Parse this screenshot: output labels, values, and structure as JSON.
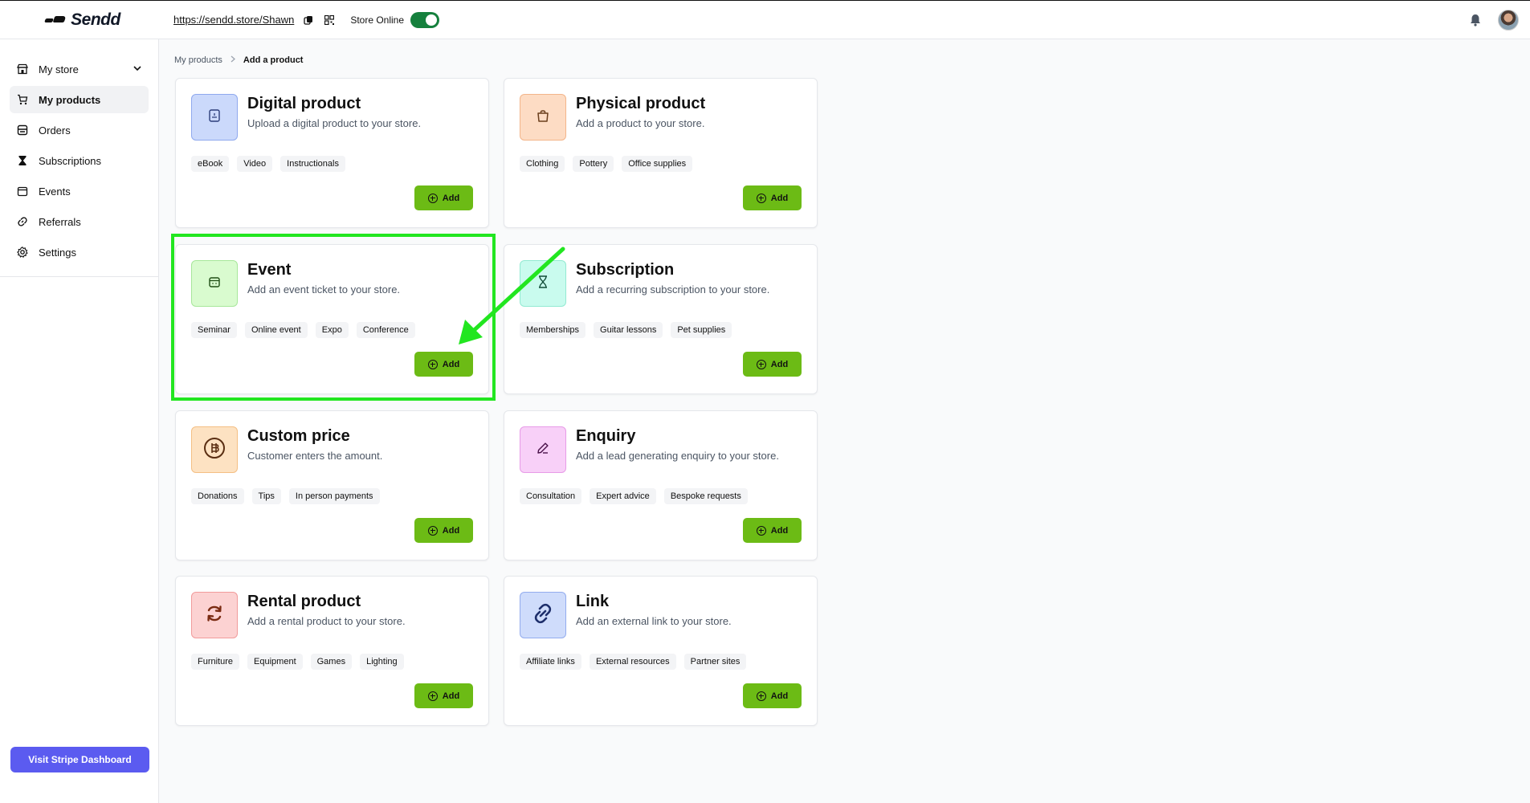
{
  "header": {
    "logo_text": "Sendd",
    "store_url": "https://sendd.store/Shawn",
    "store_status": "Store Online",
    "store_online": true
  },
  "sidebar": {
    "items": [
      {
        "label": "My store",
        "icon": "store-icon"
      },
      {
        "label": "My products",
        "icon": "cart-icon"
      },
      {
        "label": "Orders",
        "icon": "orders-icon"
      },
      {
        "label": "Subscriptions",
        "icon": "hourglass-icon"
      },
      {
        "label": "Events",
        "icon": "calendar-icon"
      },
      {
        "label": "Referrals",
        "icon": "link-icon"
      },
      {
        "label": "Settings",
        "icon": "gear-icon"
      }
    ],
    "stripe_button": "Visit Stripe Dashboard"
  },
  "breadcrumb": {
    "parent": "My products",
    "current": "Add a product"
  },
  "cards": [
    {
      "title": "Digital product",
      "desc": "Upload a digital product to your store.",
      "tags": [
        "eBook",
        "Video",
        "Instructionals"
      ],
      "add": "Add",
      "icon": "document-icon",
      "color": "#cbd9fb"
    },
    {
      "title": "Physical product",
      "desc": "Add a product to your store.",
      "tags": [
        "Clothing",
        "Pottery",
        "Office supplies"
      ],
      "add": "Add",
      "icon": "shopping-bag-icon",
      "color": "#fddcc4"
    },
    {
      "title": "Event",
      "desc": "Add an event ticket to your store.",
      "tags": [
        "Seminar",
        "Online event",
        "Expo",
        "Conference"
      ],
      "add": "Add",
      "icon": "calendar-icon",
      "color": "#d9fbcf"
    },
    {
      "title": "Subscription",
      "desc": "Add a recurring subscription to your store.",
      "tags": [
        "Memberships",
        "Guitar lessons",
        "Pet supplies"
      ],
      "add": "Add",
      "icon": "hourglass-icon",
      "color": "#c9fbee"
    },
    {
      "title": "Custom price",
      "desc": "Customer enters the amount.",
      "tags": [
        "Donations",
        "Tips",
        "In person payments"
      ],
      "add": "Add",
      "icon": "coin-icon",
      "color": "#fde2c2"
    },
    {
      "title": "Enquiry",
      "desc": "Add a lead generating enquiry to your store.",
      "tags": [
        "Consultation",
        "Expert advice",
        "Bespoke requests"
      ],
      "add": "Add",
      "icon": "pencil-icon",
      "color": "#f8d0f8"
    },
    {
      "title": "Rental product",
      "desc": "Add a rental product to your store.",
      "tags": [
        "Furniture",
        "Equipment",
        "Games",
        "Lighting"
      ],
      "add": "Add",
      "icon": "refresh-icon",
      "color": "#fcd2d2"
    },
    {
      "title": "Link",
      "desc": "Add an external link to your store.",
      "tags": [
        "Affiliate links",
        "External resources",
        "Partner sites"
      ],
      "add": "Add",
      "icon": "chain-link-icon",
      "color": "#cfdcfb"
    }
  ],
  "colors": {
    "accent_green": "#6cbb15",
    "annotation_green": "#22e620",
    "stripe_purple": "#5b5bf0",
    "toggle_green": "#15803d"
  }
}
